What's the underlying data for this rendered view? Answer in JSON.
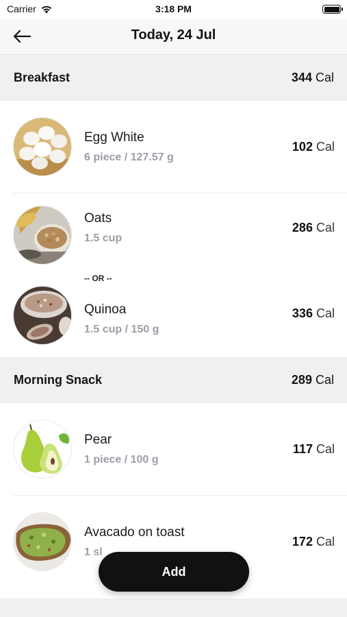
{
  "status_bar": {
    "carrier": "Carrier",
    "time": "3:18 PM"
  },
  "nav": {
    "title": "Today, 24 Jul",
    "back_icon": "arrow-left-icon"
  },
  "sections": [
    {
      "title": "Breakfast",
      "cal_value": "344",
      "cal_unit": "Cal",
      "items": [
        {
          "name": "Egg White",
          "portion": "6 piece / 127.57 g",
          "cal_value": "102",
          "cal_unit": "Cal",
          "icon": "egg-white-image"
        },
        {
          "name": "Oats",
          "portion": "1.5 cup",
          "cal_value": "286",
          "cal_unit": "Cal",
          "icon": "oats-image"
        },
        {
          "name": "Quinoa",
          "portion": "1.5 cup / 150 g",
          "cal_value": "336",
          "cal_unit": "Cal",
          "icon": "quinoa-image"
        }
      ],
      "or_label": "-- OR --"
    },
    {
      "title": "Morning Snack",
      "cal_value": "289",
      "cal_unit": "Cal",
      "items": [
        {
          "name": "Pear",
          "portion": "1 piece / 100 g",
          "cal_value": "117",
          "cal_unit": "Cal",
          "icon": "pear-image"
        },
        {
          "name": "Avacado on toast",
          "portion": "1 sl",
          "cal_value": "172",
          "cal_unit": "Cal",
          "icon": "avocado-toast-image"
        }
      ]
    }
  ],
  "add_button": {
    "label": "Add"
  }
}
